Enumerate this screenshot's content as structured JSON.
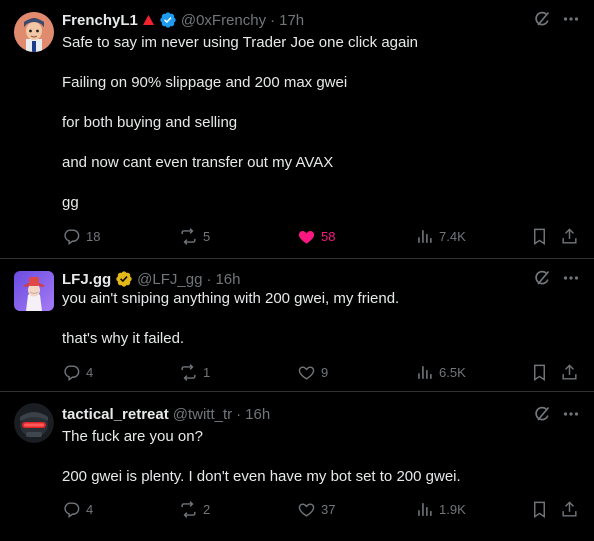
{
  "tweets": [
    {
      "author": "FrenchyL1",
      "handle": "@0xFrenchy",
      "time": "17h",
      "separator": "·",
      "paragraphs": [
        "Safe to say im never using Trader Joe one click again",
        "Failing on 90% slippage and 200 max gwei",
        "for both buying and selling",
        "and now cant even transfer out my AVAX",
        "gg"
      ],
      "stats": {
        "replies": "18",
        "reposts": "5",
        "likes": "58",
        "views": "7.4K"
      }
    },
    {
      "author": "LFJ.gg",
      "handle": "@LFJ_gg",
      "time": "16h",
      "separator": "·",
      "paragraphs": [
        "you ain't sniping anything with 200 gwei, my friend.",
        "that's why it failed."
      ],
      "stats": {
        "replies": "4",
        "reposts": "1",
        "likes": "9",
        "views": "6.5K"
      }
    },
    {
      "author": "tactical_retreat",
      "handle": "@twitt_tr",
      "time": "16h",
      "separator": "·",
      "paragraphs": [
        "The fuck are you on?",
        "200 gwei is plenty. I don't even have my bot set to 200 gwei."
      ],
      "stats": {
        "replies": "4",
        "reposts": "2",
        "likes": "37",
        "views": "1.9K"
      }
    }
  ],
  "colors": {
    "background": "#000000",
    "text": "#e7e9ea",
    "muted": "#71767b",
    "like": "#f91880",
    "verified_blue": "#1d9bf0",
    "verified_gold": "#e2b719",
    "divider": "#2f3336"
  },
  "icons": {
    "flag": "red-triangle-icon",
    "top_actions": [
      "grok-icon",
      "more-icon"
    ],
    "stats": [
      "reply-icon",
      "repost-icon",
      "like-icon",
      "views-icon",
      "bookmark-icon",
      "share-icon"
    ]
  }
}
